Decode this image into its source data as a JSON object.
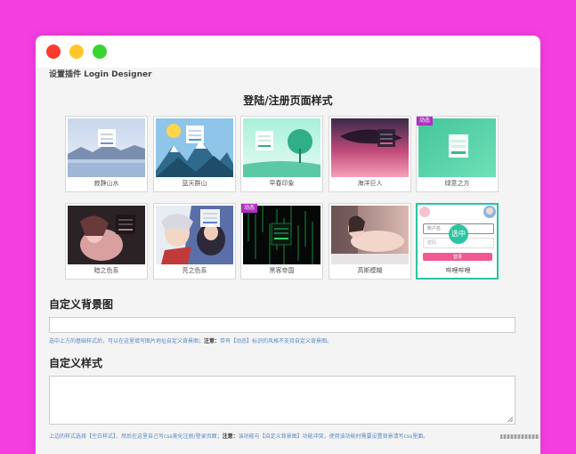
{
  "window": {
    "plugin_title": "设置插件 Login Designer"
  },
  "gallery": {
    "heading": "登陆/注册页面样式",
    "badge_text": "动态",
    "selected_text": "选中",
    "mini_form": {
      "username_placeholder": "账户名",
      "password_placeholder": "密码",
      "button_label": "登录"
    },
    "themes": [
      {
        "label": "寂静山水",
        "badge": false
      },
      {
        "label": "蓝天群山",
        "badge": false
      },
      {
        "label": "早春印象",
        "badge": false
      },
      {
        "label": "海洋巨人",
        "badge": false
      },
      {
        "label": "绿意之方",
        "badge": true
      },
      {
        "label": "暗之色系",
        "badge": false
      },
      {
        "label": "亮之色系",
        "badge": false
      },
      {
        "label": "黑客帝国",
        "badge": true
      },
      {
        "label": "高斯模糊",
        "badge": false
      },
      {
        "label": "哔哩哔哩",
        "badge": false,
        "selected": true
      }
    ]
  },
  "background": {
    "heading": "自定义背景图",
    "input_value": "",
    "help_prefix": "选中上方的基础样式后，可以在这里填写图片地址自定义背景图；",
    "help_note_label": "注意：",
    "help_note": "带有【动态】标识的风格不支持自定义背景图。"
  },
  "style": {
    "heading": "自定义样式",
    "textarea_value": "",
    "help_prefix": "上边的样式选择【空白样式】，然后在这里自己写css美化注册/登录页面；",
    "help_note_label": "注意：",
    "help_note": "该功能与【自定义背景图】功能冲突，使用该功能时需要设置背景请写css里面。"
  }
}
